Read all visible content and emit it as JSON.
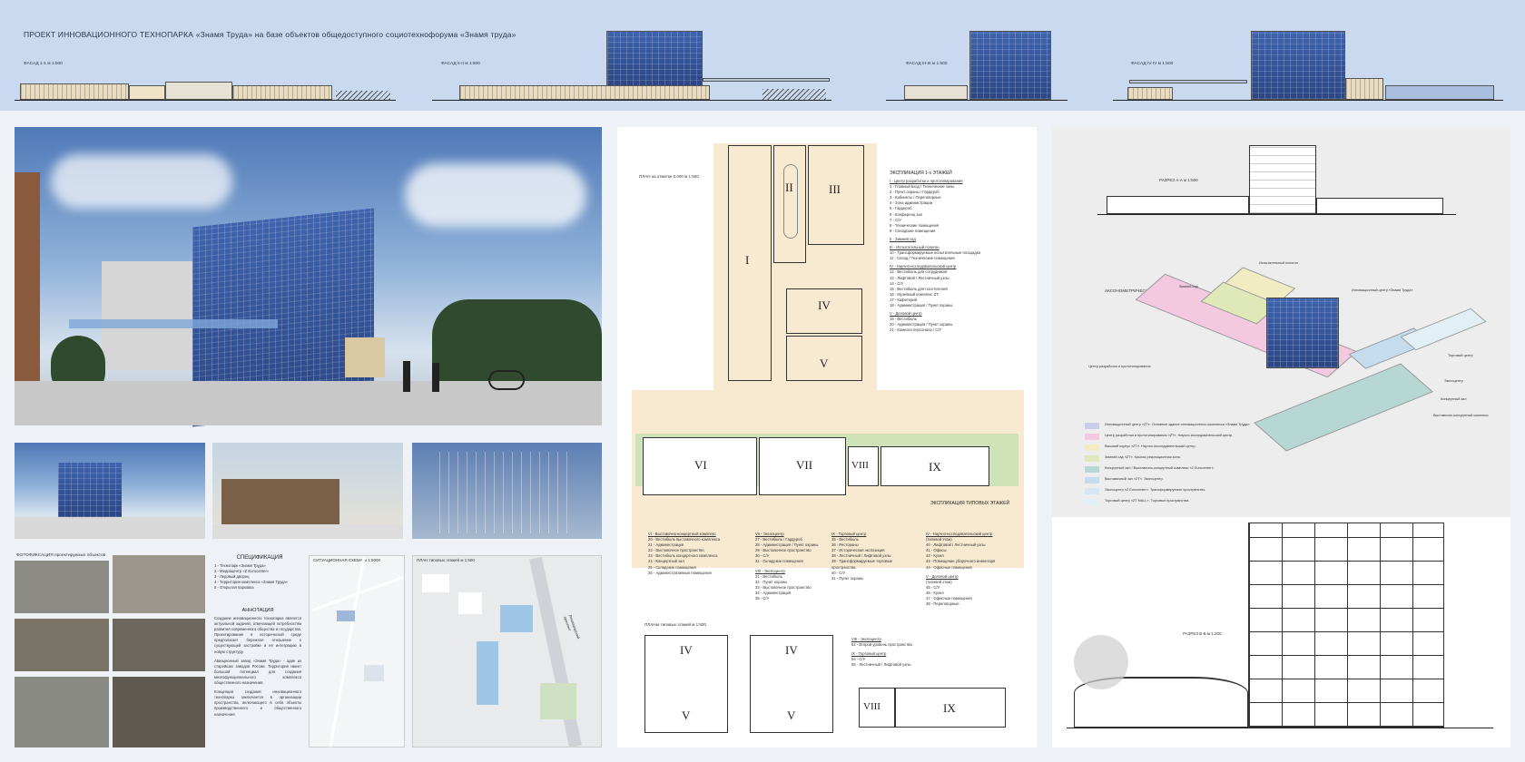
{
  "header": {
    "title": "ПРОЕКТ ИННОВАЦИОННОГО ТЕХНОПАРКА «Знамя Труда» на базе объектов общедоступного социотехнофорума «Знамя труда»",
    "facades": [
      {
        "label": "ФАСАД 1-1   м 1:500"
      },
      {
        "label": "ФАСАД II-II   м 1:500"
      },
      {
        "label": "ФАСАД III-III   м 1:500"
      },
      {
        "label": "ФАСАД IV-IV   м 1:500"
      }
    ]
  },
  "photos_section": {
    "title": "ФОТОФИКСАЦИЯ проектируемых объектов"
  },
  "spec": {
    "title": "СПЕЦИФИКАЦИЯ",
    "items": [
      "1 - Технопарк «Знамя Труда»",
      "2 - Медиацентр «Z Eurocenter»",
      "3 - Ледовый дворец",
      "4 - Территория комплекса «Знамя Труда»",
      "5 - Открытая парковка"
    ]
  },
  "annotation": {
    "title": "АННОТАЦИЯ",
    "p1": "Создание инновационного технопарка является актуальной задачей, отвечающей потребностям развития современного общества и государства. Проектирование в исторической среде предполагает бережное отношение к существующей застройке и её интеграцию в новую структуру.",
    "p2": "Авиационный завод «Знамя Труда» - один из старейших заводов России. Территория имеет большой потенциал для создания многофункционального комплекса общественного назначения.",
    "p3": "Концепция создания инновационного технопарка заключается в организации пространства, включающего в себя объекты производственного и общественного назначения."
  },
  "maps": {
    "situation": "СИТУАЦИОННАЯ СХЕМА   м 1:5000",
    "typical": "ПЛАН типовых этажей   м 1:500",
    "street": "Ленинградский проспект"
  },
  "plan": {
    "title_ground": "ПЛАН на отметке 0.000   м 1:500",
    "title_typical": "ПЛАНЫ типовых этажей   м 1:500",
    "romans": [
      "I",
      "II",
      "III",
      "IV",
      "V",
      "VI",
      "VII",
      "VIII",
      "IX"
    ],
    "explication_title": "ЭКСПЛИКАЦИЯ 1-х ЭТАЖЕЙ",
    "explication_typical": "ЭКСПЛИКАЦИЯ ТИПОВЫХ ЭТАЖЕЙ",
    "expl_groups": [
      {
        "head": "I - Центр разработки и прототипирования",
        "lines": [
          "1 - Главный вход / Технические зоны",
          "2 - Пункт охраны / Гардероб",
          "3 - Кабинеты / Переговорные",
          "4 - Зона администрации",
          "5 - Гардероб",
          "6 - Конференц зал",
          "7 - С/У",
          "8 - Технические помещения",
          "9 - Складские помещения"
        ]
      },
      {
        "head": "II - Зимний сад",
        "lines": []
      },
      {
        "head": "III - Испытательный полигон",
        "lines": [
          "10 - Трансформируемые испытательные площадки",
          "11 - Склад / Технические помещения"
        ]
      },
      {
        "head": "IV - Научно-исследовательский центр",
        "lines": [
          "12 - Вестибюль для сотрудников",
          "13 - Лифтовой / Лестничный узлы",
          "14 - С/У",
          "15 - Вестибюль для посетителей",
          "16 - Музейный комплекс ZT",
          "17 - Кафетерий",
          "18 - Администрация / Пункт охраны"
        ]
      },
      {
        "head": "V - Деловой центр",
        "lines": [
          "19 - Вестибюль",
          "20 - Администрация / Пункт охраны",
          "21 - Комната персонала / С/У"
        ]
      }
    ],
    "expl_bottom": [
      {
        "head": "VI - Выставочно-концертный комплекс",
        "lines": [
          "20 - Вестибюль выставочного комплекса",
          "21 - Администрация",
          "22 - Выставочное пространство",
          "23 - Вестибюль концертного комплекса",
          "24 - Концертный зал",
          "25 - Складские помещения",
          "26 - Административные помещения"
        ]
      },
      {
        "head": "VII - Экспоцентр",
        "lines": [
          "27 - Вестибюль / Гардероб",
          "28 - Администрация / Пункт охраны",
          "29 - Выставочное пространство",
          "30 - С/У",
          "31 - Складские помещения"
        ]
      },
      {
        "head": "VIII - Экспоцентр",
        "lines": [
          "31 - Вестибюль",
          "32 - Пункт охраны",
          "33 - Выставочное пространство",
          "34 - Администрация",
          "35 - С/У"
        ]
      },
      {
        "head": "IX - Торговый центр",
        "lines": [
          "35 - Вестибюль",
          "36 - Рестораны",
          "37 - Историческая экспозиция",
          "38 - Лестничный / Лифтовой узлы",
          "39 - Трансформируемые торговые пространства",
          "40 - С/У",
          "41 - Пункт охраны"
        ]
      }
    ],
    "expl_right_bottom": [
      {
        "head": "IV - Научно-исследовательский центр",
        "lines": [
          "(типовой этаж)",
          "40 - Лифтовой / Лестничный узлы",
          "41 - Офисы",
          "42 - Кухня",
          "43 - Помещение уборочного инвентаря",
          "44 - Офисные помещения"
        ]
      },
      {
        "head": "V - Деловой центр",
        "lines": [
          "(типовой этаж)",
          "45 - С/У",
          "46 - Кухня",
          "47 - Офисные помещения",
          "48 - Переговорные"
        ]
      }
    ],
    "expl_small": [
      {
        "head": "VIII - Экспоцентр",
        "lines": [
          "52 - Второй уровень пространства"
        ]
      },
      {
        "head": "IX - Торговый центр",
        "lines": [
          "54 - С/У",
          "55 - Лестничный / Лифтовой узлы"
        ]
      }
    ]
  },
  "right": {
    "section_aa": "РАЗРЕЗ А-А   м 1:500",
    "axon": "АКСОНОМЕТРИЧЕСКАЯ МОДЕЛЬ",
    "section_bb": "РАЗРЕЗ Б-Б   м 1:200",
    "axon_labels": [
      "Зимний сад",
      "Испытательный полигон",
      "Инновационный центр «Знамя Труда»",
      "Центр разработки и прототипирования",
      "Торговый центр",
      "Экспоцентр",
      "Концертный зал",
      "Выставочно-концертный комплекс"
    ],
    "legend": [
      {
        "color": "#c9cde8",
        "text": "Инновационный центр «ZT». Основное здание инновационного комплекса «Знамя Труда»."
      },
      {
        "color": "#f2c9df",
        "text": "Центр разработки и прототипирования «ZT». Научно-исследовательский центр."
      },
      {
        "color": "#f1ecc2",
        "text": "Высокий корпус «ZT». Научно-исследовательский центр."
      },
      {
        "color": "#dfe8b8",
        "text": "Зимний сад «ZT». Крытая рекреационная зона."
      },
      {
        "color": "#b7d7d3",
        "text": "Концертный зал / Выставочно-концертный комплекс «Z Eurocenter»."
      },
      {
        "color": "#c5dcee",
        "text": "Выставочный зал «ZT». Экспоцентр."
      },
      {
        "color": "#d6e6f3",
        "text": "Экспоцентр «Z Eurocenter». Трансформируемое пространство."
      },
      {
        "color": "#e2eff4",
        "text": "Торговый центр «ZT MALL». Торговые пространства."
      }
    ]
  }
}
